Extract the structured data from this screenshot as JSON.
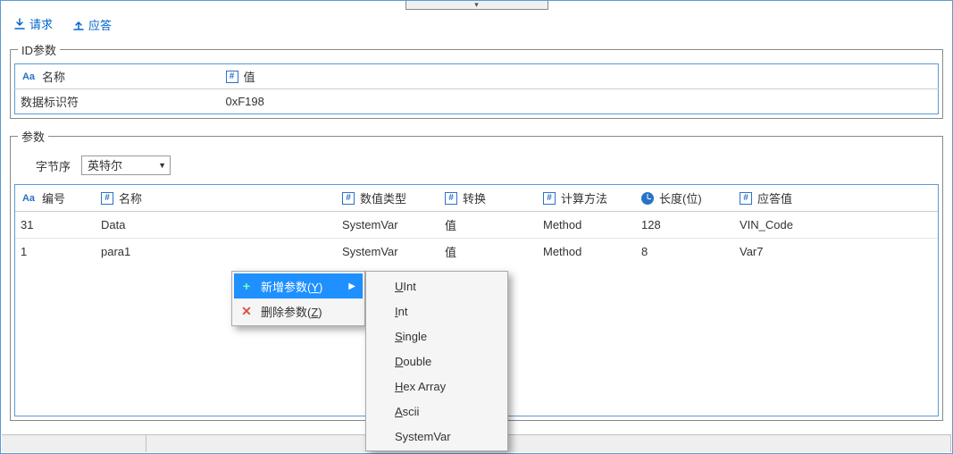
{
  "tabs": {
    "request": "请求",
    "response": "应答"
  },
  "idSection": {
    "legend": "ID参数",
    "headers": {
      "name": "名称",
      "value": "值"
    },
    "row": {
      "name": "数据标识符",
      "value": "0xF198"
    }
  },
  "paramsSection": {
    "legend": "参数",
    "byteOrderLabel": "字节序",
    "byteOrderValue": "英特尔",
    "headers": {
      "index": "编号",
      "name": "名称",
      "type": "数值类型",
      "convert": "转换",
      "calc": "计算方法",
      "length": "长度(位)",
      "resp": "应答值"
    },
    "rows": [
      {
        "index": "31",
        "name": "Data",
        "type": "SystemVar",
        "convert": "值",
        "calc": "Method",
        "length": "128",
        "resp": "VIN_Code"
      },
      {
        "index": "1",
        "name": "para1",
        "type": "SystemVar",
        "convert": "值",
        "calc": "Method",
        "length": "8",
        "resp": "Var7"
      }
    ]
  },
  "contextMenu": {
    "add": {
      "label": "新增参数(",
      "hotkey": "Y",
      "tail": ")"
    },
    "del": {
      "label": "删除参数(",
      "hotkey": "Z",
      "tail": ")"
    }
  },
  "subMenu": {
    "items": [
      {
        "first": "U",
        "rest": "Int"
      },
      {
        "first": "I",
        "rest": "nt"
      },
      {
        "first": "S",
        "rest": "ingle"
      },
      {
        "first": "D",
        "rest": "ouble"
      },
      {
        "first": "H",
        "rest": "ex Array"
      },
      {
        "first": "A",
        "rest": "scii"
      },
      {
        "first": "",
        "rest": "SystemVar"
      }
    ]
  }
}
